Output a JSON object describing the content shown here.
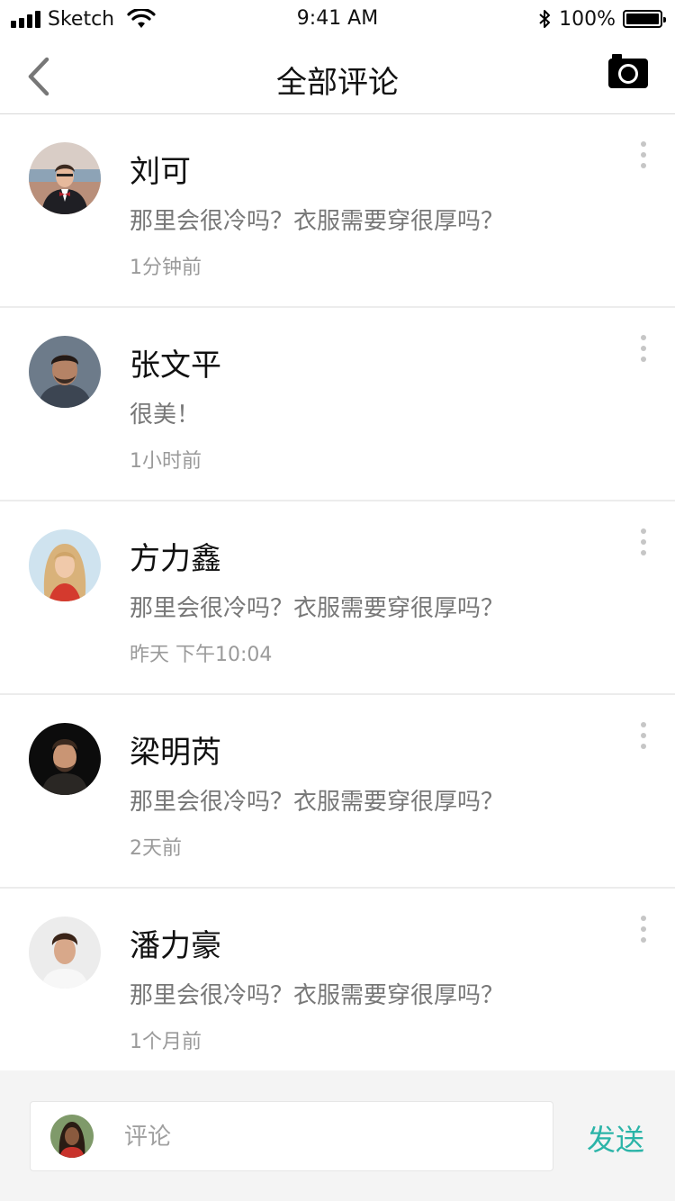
{
  "status_bar": {
    "carrier": "Sketch",
    "time": "9:41 AM",
    "battery": "100%"
  },
  "nav": {
    "title": "全部评论"
  },
  "comments": [
    {
      "name": "刘可",
      "text": "那里会很冷吗？衣服需要穿很厚吗？",
      "time": "1分钟前"
    },
    {
      "name": "张文平",
      "text": "很美！",
      "time": "1小时前"
    },
    {
      "name": "方力鑫",
      "text": "那里会很冷吗？衣服需要穿很厚吗？",
      "time": "昨天 下午10:04"
    },
    {
      "name": "梁明芮",
      "text": "那里会很冷吗？衣服需要穿很厚吗？",
      "time": "2天前"
    },
    {
      "name": "潘力豪",
      "text": "那里会很冷吗？衣服需要穿很厚吗？",
      "time": "1个月前"
    }
  ],
  "composer": {
    "placeholder": "评论",
    "send_label": "发送"
  },
  "colors": {
    "accent": "#2bb4a8",
    "secondary_text": "#777777",
    "divider": "#ececec"
  }
}
